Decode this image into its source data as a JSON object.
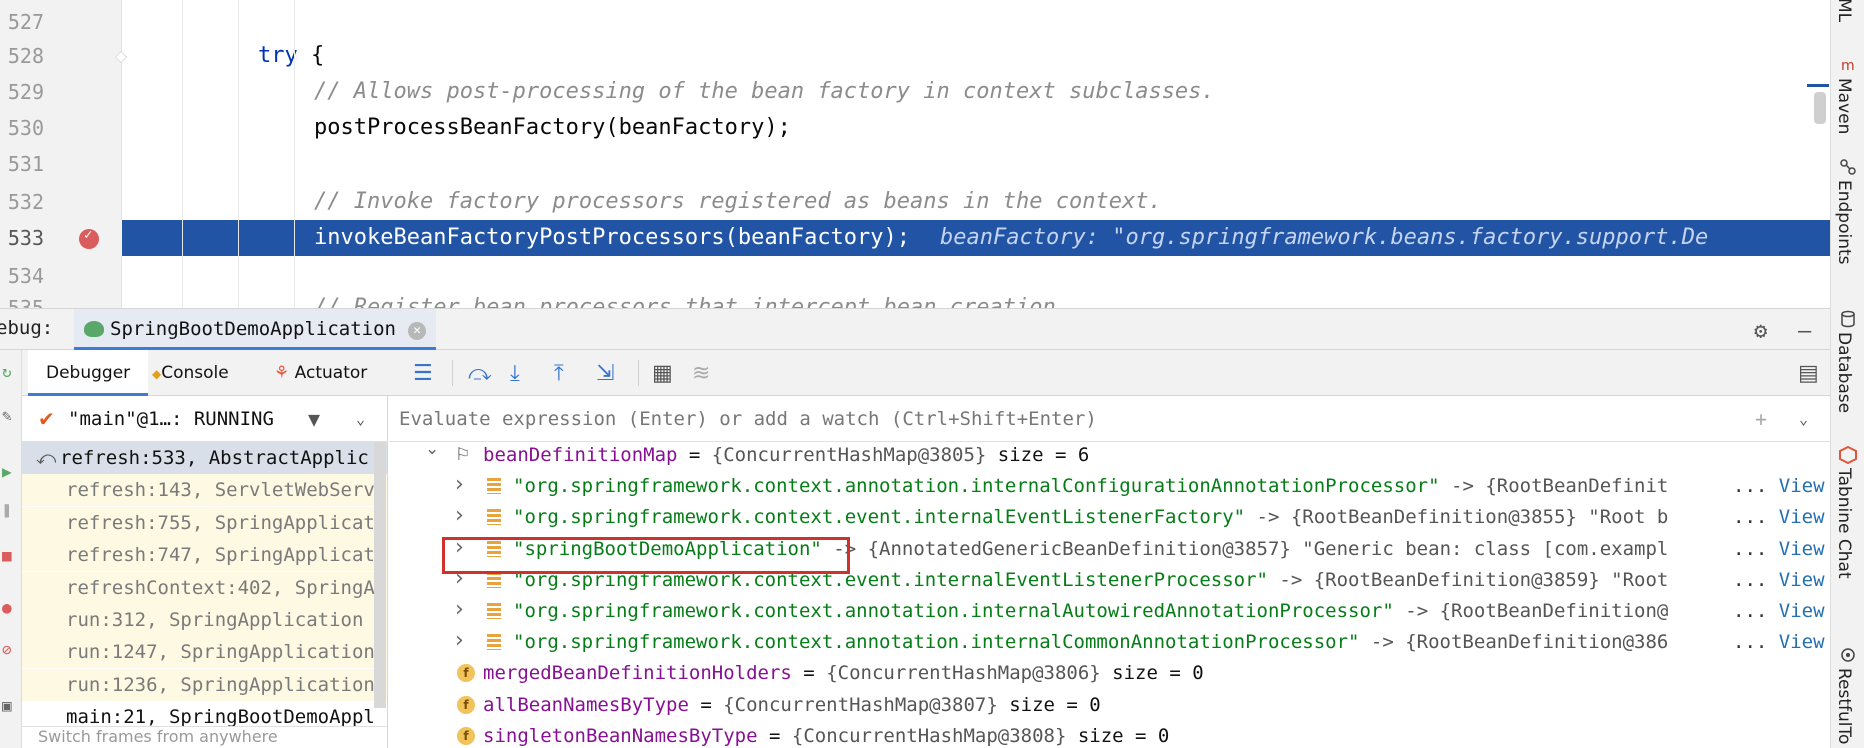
{
  "editor": {
    "lines": [
      {
        "n": "527",
        "tokens": []
      },
      {
        "n": "528",
        "tokens": [
          {
            "t": "try ",
            "c": "kw"
          },
          {
            "t": "{",
            "c": ""
          }
        ],
        "indent": 258
      },
      {
        "n": "529",
        "tokens": [
          {
            "t": "// Allows post-processing of the bean factory in context subclasses.",
            "c": "cmt"
          }
        ],
        "indent": 314
      },
      {
        "n": "530",
        "tokens": [
          {
            "t": "postProcessBeanFactory(beanFactory);",
            "c": ""
          }
        ],
        "indent": 314
      },
      {
        "n": "531",
        "tokens": []
      },
      {
        "n": "532",
        "tokens": [
          {
            "t": "// Invoke factory processors registered as beans in the context.",
            "c": "cmt"
          }
        ],
        "indent": 314
      },
      {
        "n": "533",
        "tokens": [
          {
            "t": "invokeBeanFactoryPostProcessors(beanFactory);",
            "c": ""
          }
        ],
        "indent": 314,
        "selected": true,
        "inline_value": "beanFactory: \"org.springframework.beans.factory.support.De"
      },
      {
        "n": "534",
        "tokens": []
      },
      {
        "n": "535",
        "tokens": [
          {
            "t": "// Register bean processors that intercept bean creation.",
            "c": "cmt"
          }
        ],
        "indent": 314
      }
    ]
  },
  "right_strip": {
    "tabs": [
      "ML",
      "Maven",
      "Endpoints",
      "Database",
      "Tabnine Chat",
      "RestfulTo"
    ]
  },
  "debug": {
    "label": "ebug:",
    "run_tab": "SpringBootDemoApplication",
    "toolbar": {
      "debugger_tab": "Debugger",
      "console_tab": "Console",
      "actuator_tab": "Actuator"
    },
    "thread": "\"main\"@1…: RUNNING",
    "frames": [
      "refresh:533, AbstractApplic",
      "refresh:143, ServletWebServ",
      "refresh:755, SpringApplicat",
      "refresh:747, SpringApplicat",
      "refreshContext:402, SpringA",
      "run:312, SpringApplication",
      "run:1247, SpringApplication",
      "run:1236, SpringApplication",
      "main:21, SpringBootDemoAppl"
    ],
    "frames_hint": "Switch frames from anywhere",
    "eval_placeholder": "Evaluate expression (Enter) or add a watch (Ctrl+Shift+Enter)",
    "variables": [
      {
        "level": 0,
        "expanded": true,
        "icon": "flag",
        "name": "beanDefinitionMap",
        "rest": " = ",
        "val": "{ConcurrentHashMap@3805}",
        "extra": "  size = 6"
      },
      {
        "level": 1,
        "icon": "entry",
        "key": "\"org.springframework.context.annotation.internalConfigurationAnnotationProcessor\"",
        "rest": " -> {RootBeanDefinit",
        "view": "View"
      },
      {
        "level": 1,
        "icon": "entry",
        "key": "\"org.springframework.context.event.internalEventListenerFactory\"",
        "rest": " -> {RootBeanDefinition@3855} \"Root b",
        "view": "View"
      },
      {
        "level": 1,
        "icon": "entry",
        "key": "\"springBootDemoApplication\"",
        "rest": " -> {AnnotatedGenericBeanDefinition@3857} \"Generic bean: class [com.exampl",
        "view": "View"
      },
      {
        "level": 1,
        "icon": "entry",
        "key": "\"org.springframework.context.event.internalEventListenerProcessor\"",
        "rest": " -> {RootBeanDefinition@3859} \"Root",
        "view": "View"
      },
      {
        "level": 1,
        "icon": "entry",
        "key": "\"org.springframework.context.annotation.internalAutowiredAnnotationProcessor\"",
        "rest": " -> {RootBeanDefinition@",
        "view": "View"
      },
      {
        "level": 1,
        "icon": "entry",
        "key": "\"org.springframework.context.annotation.internalCommonAnnotationProcessor\"",
        "rest": " -> {RootBeanDefinition@386",
        "view": "View"
      },
      {
        "level": 0,
        "icon": "field",
        "name": "mergedBeanDefinitionHolders",
        "rest": " = ",
        "val": "{ConcurrentHashMap@3806}",
        "extra": "  size = 0"
      },
      {
        "level": 0,
        "icon": "field",
        "name": "allBeanNamesByType",
        "rest": " = ",
        "val": "{ConcurrentHashMap@3807}",
        "extra": "  size = 0"
      },
      {
        "level": 0,
        "icon": "field",
        "name": "singletonBeanNamesByType",
        "rest": " = ",
        "val": "{ConcurrentHashMap@3808}",
        "extra": "  size = 0"
      }
    ]
  },
  "colors": {
    "selection": "#2154a5",
    "highlight_box": "#d0312d",
    "string": "#067d17",
    "field_name": "#871094"
  }
}
